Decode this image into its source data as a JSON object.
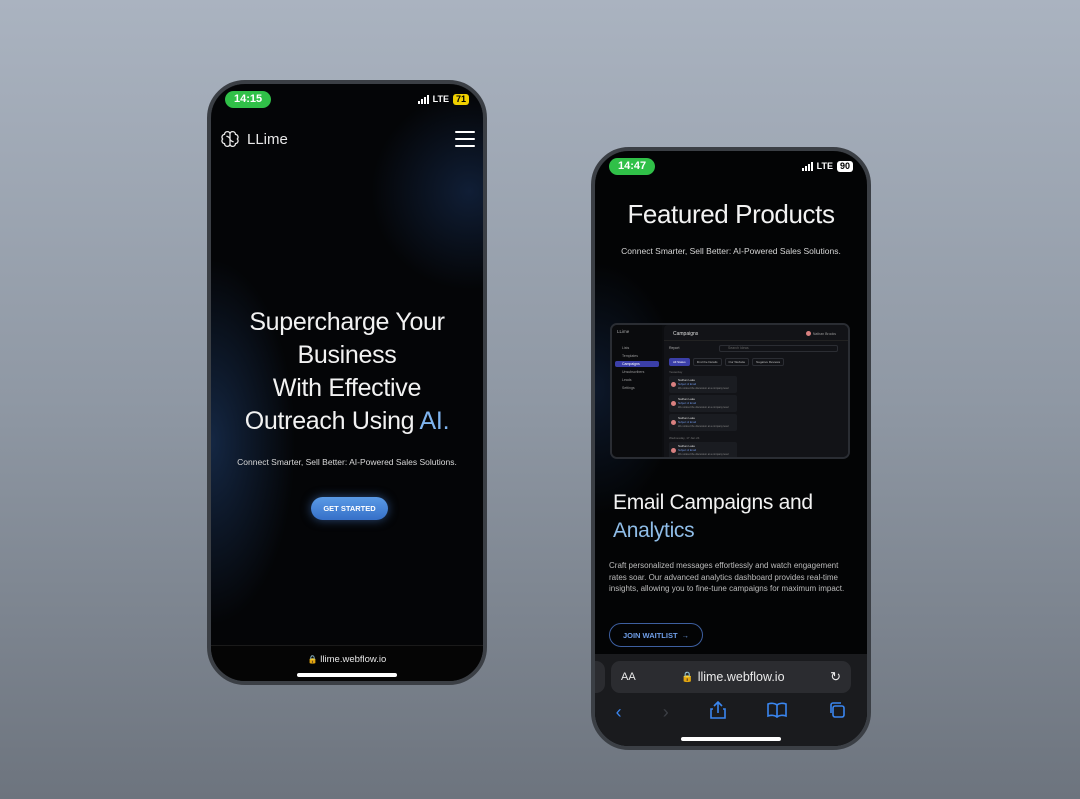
{
  "left_phone": {
    "status": {
      "time": "14:15",
      "network": "LTE",
      "battery": "71"
    },
    "brand": {
      "name": "LLime",
      "icon": "brain-icon"
    },
    "hero": {
      "line1": "Supercharge Your",
      "line2": "Business",
      "line3": "With Effective",
      "line4_prefix": "Outreach Using ",
      "line4_accent": "AI.",
      "subtitle": "Connect Smarter, Sell Better: AI-Powered Sales Solutions.",
      "cta": "GET STARTED"
    },
    "url": "llime.webflow.io"
  },
  "right_phone": {
    "status": {
      "time": "14:47",
      "network": "LTE",
      "battery": "90"
    },
    "title": "Featured Products",
    "subtitle": "Connect Smarter, Sell Better: AI-Powered Sales Solutions.",
    "dashboard": {
      "logo": "LLime",
      "header": "Campaigns",
      "user": "Nathan Brooks",
      "select": "Report",
      "search_placeholder": "Search Ideas",
      "nav": [
        "Lists",
        "Templates",
        "Campaigns",
        "Unsubscribers",
        "Leads",
        "Settings"
      ],
      "filters": [
        "All Status",
        "Find the Details",
        "Our Website",
        "Negative Reviews"
      ],
      "section1": "Yesterday",
      "section2": "Wednesday, 17 Jan 24",
      "cards": [
        {
          "name": "Nathan Lake",
          "subject": "Subject of Email",
          "text": "We noticed the discussion at a company level"
        },
        {
          "name": "Nathan Lake",
          "subject": "Subject of Email",
          "text": "We noticed the discussion at a company level"
        },
        {
          "name": "Nathan Lake",
          "subject": "Subject of Email",
          "text": "We noticed the discussion at a company level"
        },
        {
          "name": "Nathan Lake",
          "subject": "Subject of Email",
          "text": "We noticed the discussion at a company level"
        }
      ]
    },
    "section": {
      "title_line1": "Email Campaigns and",
      "title_line2": "Analytics",
      "body": "Craft personalized messages effortlessly and watch engagement rates soar. Our advanced analytics dashboard provides real-time insights, allowing you to fine-tune campaigns for maximum impact.",
      "cta": "JOIN WAITLIST"
    },
    "browser": {
      "aa": "AA",
      "url": "llime.webflow.io"
    }
  },
  "colors": {
    "accent_blue": "#5a9ae6",
    "ai_blue": "#7fb4ee",
    "status_green": "#30c048",
    "battery_yellow": "#f0d000"
  }
}
